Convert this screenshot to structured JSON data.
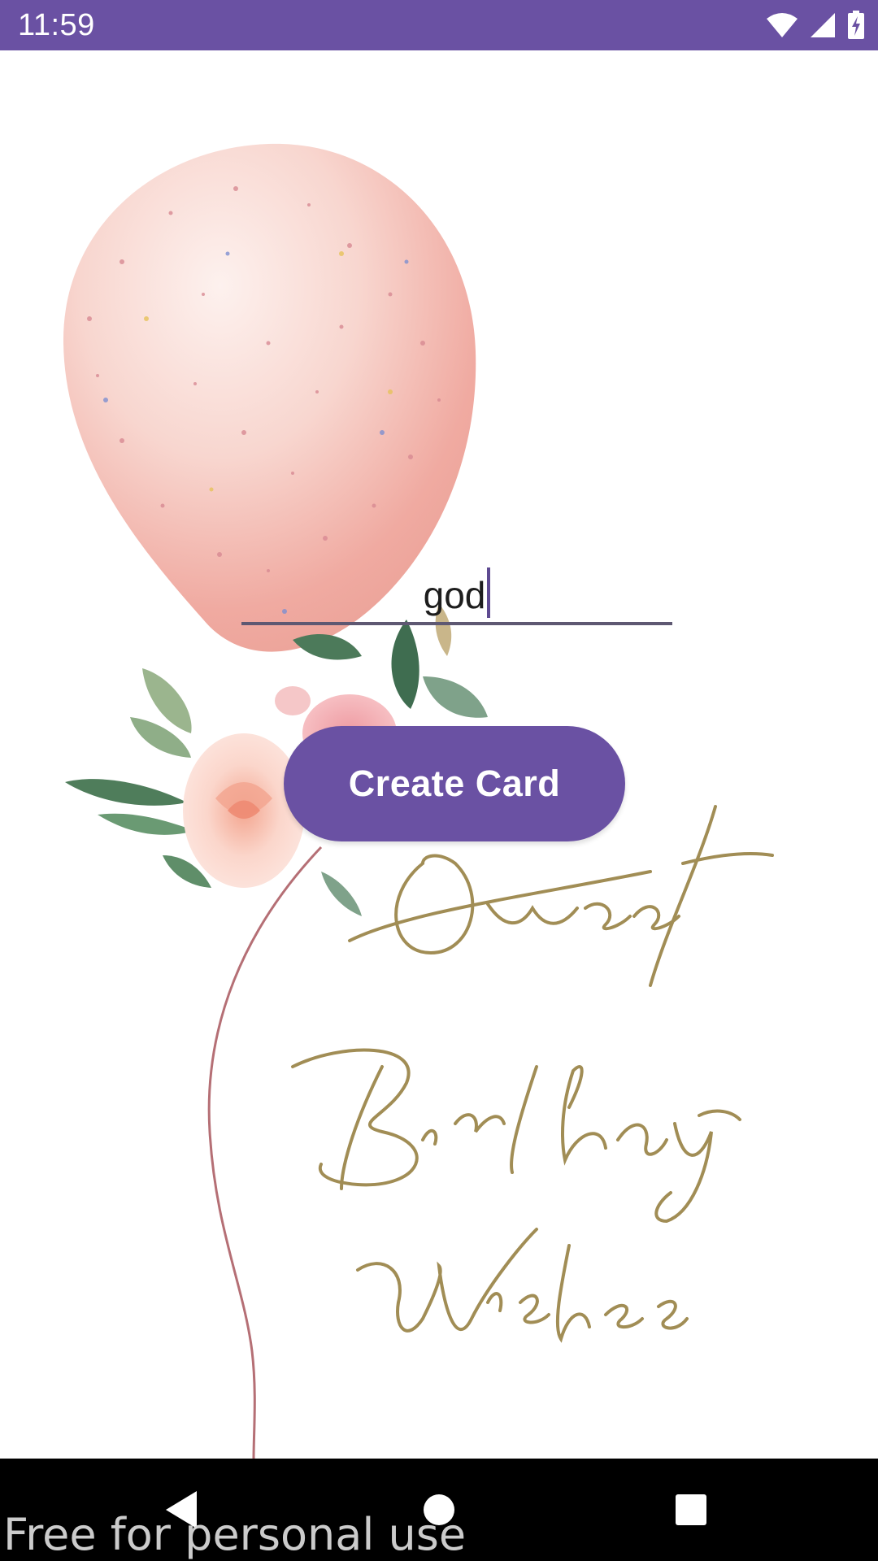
{
  "status_bar": {
    "time": "11:59",
    "background_color": "#6a51a3",
    "icons": [
      "wifi-icon",
      "cellular-signal-icon",
      "battery-charging-icon"
    ]
  },
  "card": {
    "art_description_icons": [
      "balloon-icon",
      "floral-bouquet-icon"
    ]
  },
  "name_input": {
    "value": "god"
  },
  "create_button": {
    "label": "Create Card",
    "background_color": "#6a51a3"
  },
  "nav_bar": {
    "icons": [
      "back-icon",
      "home-icon",
      "recents-icon"
    ]
  },
  "watermark": {
    "text": "Free for personal use"
  }
}
